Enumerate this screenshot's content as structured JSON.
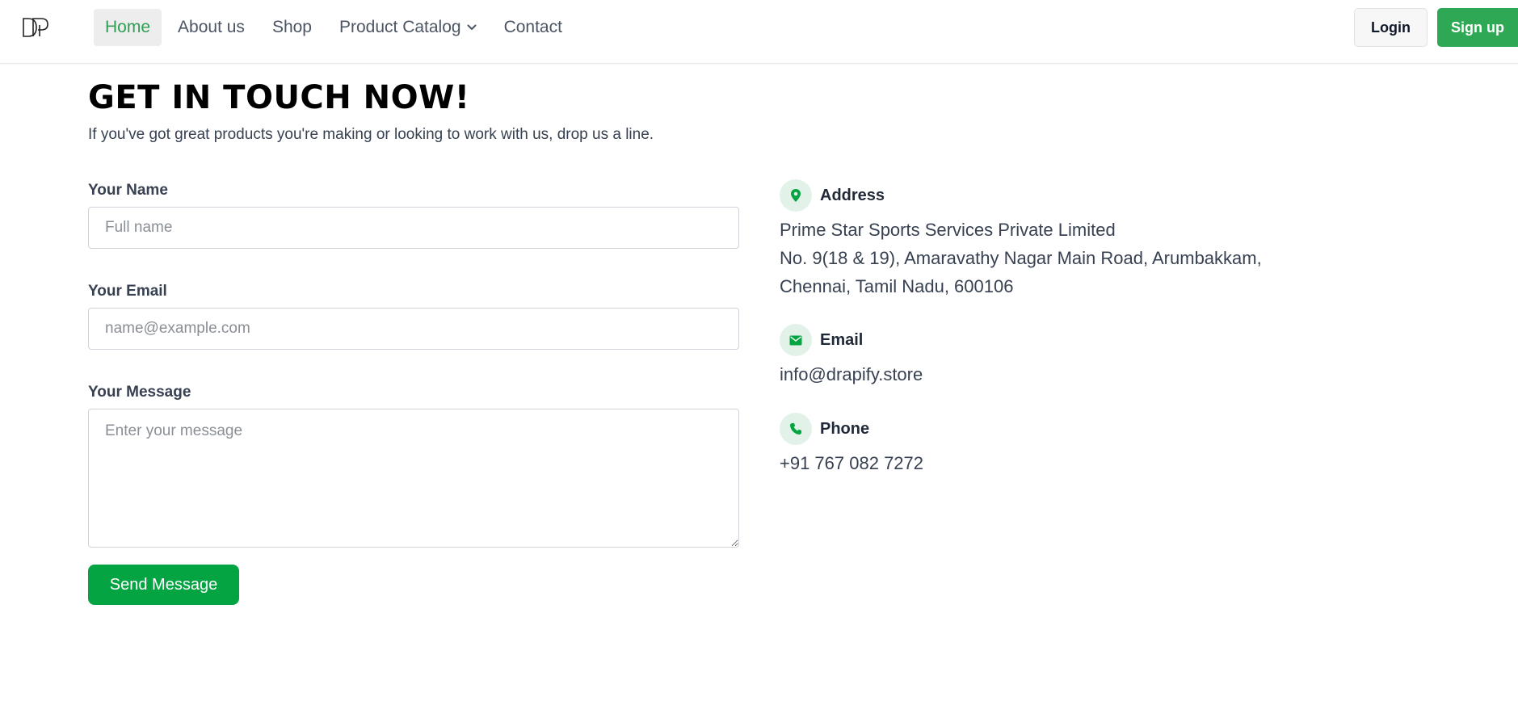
{
  "nav": {
    "logo_text": "DP",
    "links": [
      {
        "label": "Home",
        "active": true
      },
      {
        "label": "About us"
      },
      {
        "label": "Shop"
      },
      {
        "label": "Product Catalog",
        "has_dropdown": true
      },
      {
        "label": "Contact"
      }
    ],
    "login_label": "Login",
    "signup_label": "Sign up"
  },
  "page": {
    "title": "GET IN TOUCH NOW!",
    "subtitle": "If you've got great products you're making or looking to work with us, drop us a line."
  },
  "form": {
    "name": {
      "label": "Your Name",
      "placeholder": "Full name",
      "value": ""
    },
    "email": {
      "label": "Your Email",
      "placeholder": "name@example.com",
      "value": ""
    },
    "message": {
      "label": "Your Message",
      "placeholder": "Enter your message",
      "value": ""
    },
    "submit_label": "Send Message"
  },
  "contact": {
    "address": {
      "title": "Address",
      "icon": "map-pin-icon",
      "lines": [
        "Prime Star Sports Services Private Limited",
        "No. 9(18 & 19), Amaravathy Nagar Main Road, Arumbakkam,",
        "Chennai, Tamil Nadu, 600106"
      ]
    },
    "email": {
      "title": "Email",
      "icon": "envelope-icon",
      "value": "info@drapify.store"
    },
    "phone": {
      "title": "Phone",
      "icon": "phone-icon",
      "value": "+91 767 082 7272"
    }
  },
  "colors": {
    "accent": "#2ea855",
    "button": "#05a443",
    "icon_bg": "#e3f2e8",
    "active_link": "#2f9e55"
  }
}
